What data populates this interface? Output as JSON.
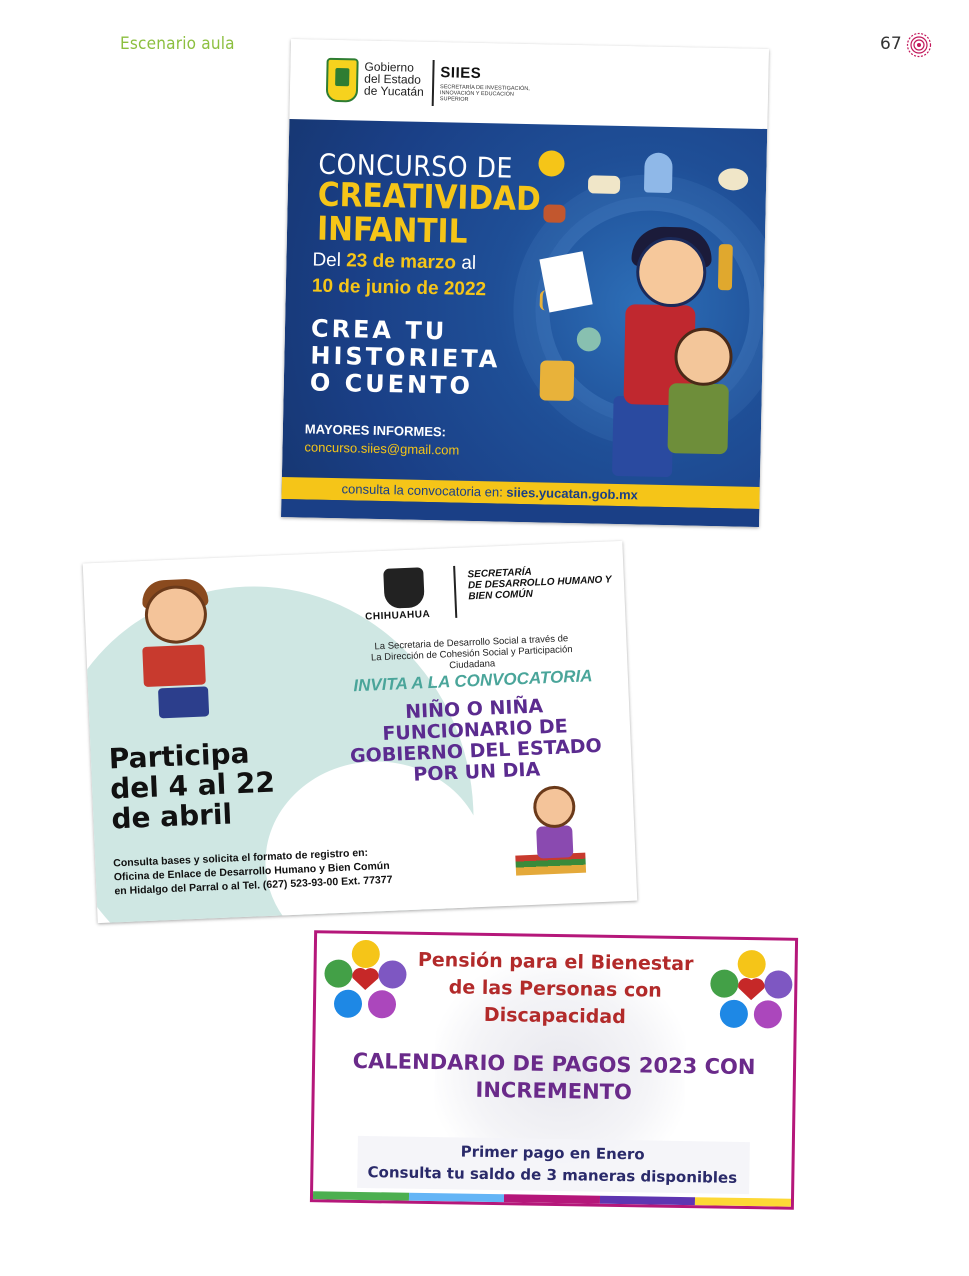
{
  "page": {
    "section_title": "Escenario aula",
    "page_number": "67"
  },
  "poster1": {
    "gov_line1": "Gobierno",
    "gov_line2": "del Estado",
    "gov_line3": "de Yucatán",
    "siies": "SIIES",
    "siies_sub": "SECRETARÍA DE INVESTIGACIÓN, INNOVACIÓN Y EDUCACIÓN SUPERIOR",
    "title_line1": "CONCURSO DE",
    "title_line2": "CREATIVIDAD",
    "title_line3": "INFANTIL",
    "date_del": "Del ",
    "date_start": "23 de marzo",
    "date_al": " al",
    "date_end": "10 de junio de 2022",
    "crea_line1": "CREA TU",
    "crea_line2": "HISTORIETA",
    "crea_line3": "O CUENTO",
    "info_label": "MAYORES INFORMES:",
    "email": "concurso.siies@gmail.com",
    "consulta": "consulta la convocatoria en: ",
    "url": "siies.yucatan.gob.mx"
  },
  "poster2": {
    "state": "CHIHUAHUA",
    "sec_line1": "SECRETARÍA",
    "sec_line2": "DE DESARROLLO HUMANO Y BIEN COMÚN",
    "intro_line1": "La Secretaria de Desarrollo Social a través de",
    "intro_line2": "La Dirección de Cohesión Social y Participación Ciudadana",
    "invita": "INVITA A LA CONVOCATORIA",
    "main_line1": "NIÑO O NIÑA",
    "main_line2": "FUNCIONARIO DE",
    "main_line3": "GOBIERNO DEL ESTADO",
    "main_line4": "POR UN DIA",
    "participa_line1": "Participa",
    "participa_line2": "del 4 al 22",
    "participa_line3": "de abril",
    "consulta_line1": "Consulta bases y solicita el formato de registro en:",
    "consulta_line2": "Oficina de Enlace de Desarrollo Humano y Bien Común",
    "consulta_line3": "en Hidalgo del Parral o al Tel. (627) 523-93-00 Ext. 77377"
  },
  "poster3": {
    "title_line1": "Pensión para el Bienestar",
    "title_line2": "de las Personas con",
    "title_line3": "Discapacidad",
    "cal_line1": "CALENDARIO DE PAGOS 2023 CON",
    "cal_line2": "INCREMENTO",
    "pago_line1": "Primer pago en Enero",
    "pago_line2": "Consulta tu saldo de 3 maneras disponibles",
    "stripe_colors": [
      "#4caf50",
      "#64b5f6",
      "#b5177a",
      "#5e35b1",
      "#fdd835"
    ]
  }
}
